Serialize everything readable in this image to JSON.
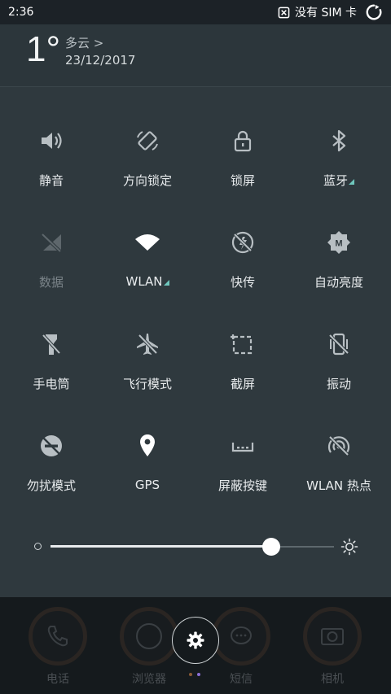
{
  "status_bar": {
    "time": "2:36",
    "sim_text": "没有 SIM 卡"
  },
  "weather": {
    "temperature": "1°",
    "condition": "多云 >",
    "date": "23/12/2017"
  },
  "quick_settings": [
    {
      "label": "静音",
      "icon": "volume-icon",
      "has_more": false,
      "dim": false
    },
    {
      "label": "方向锁定",
      "icon": "rotation-lock-icon",
      "has_more": false,
      "dim": false
    },
    {
      "label": "锁屏",
      "icon": "lock-icon",
      "has_more": false,
      "dim": false
    },
    {
      "label": "蓝牙",
      "icon": "bluetooth-icon",
      "has_more": true,
      "dim": false
    },
    {
      "label": "数据",
      "icon": "mobile-data-off-icon",
      "has_more": false,
      "dim": true
    },
    {
      "label": "WLAN",
      "icon": "wifi-icon",
      "has_more": true,
      "dim": false
    },
    {
      "label": "快传",
      "icon": "quick-transfer-icon",
      "has_more": false,
      "dim": false
    },
    {
      "label": "自动亮度",
      "icon": "auto-brightness-icon",
      "has_more": false,
      "dim": false
    },
    {
      "label": "手电筒",
      "icon": "flashlight-icon",
      "has_more": false,
      "dim": false
    },
    {
      "label": "飞行模式",
      "icon": "airplane-mode-icon",
      "has_more": false,
      "dim": false
    },
    {
      "label": "截屏",
      "icon": "screenshot-icon",
      "has_more": false,
      "dim": false
    },
    {
      "label": "振动",
      "icon": "vibrate-icon",
      "has_more": false,
      "dim": false
    },
    {
      "label": "勿扰模式",
      "icon": "do-not-disturb-icon",
      "has_more": false,
      "dim": false
    },
    {
      "label": "GPS",
      "icon": "location-icon",
      "has_more": false,
      "dim": false
    },
    {
      "label": "屏蔽按键",
      "icon": "block-keys-icon",
      "has_more": false,
      "dim": false
    },
    {
      "label": "WLAN 热点",
      "icon": "hotspot-icon",
      "has_more": false,
      "dim": false
    }
  ],
  "brightness": {
    "level": 0.78
  },
  "dock": {
    "apps": [
      {
        "label": "电话",
        "icon": "phone-icon"
      },
      {
        "label": "浏览器",
        "icon": "browser-icon"
      },
      {
        "label": "短信",
        "icon": "messages-icon"
      },
      {
        "label": "相机",
        "icon": "camera-icon"
      }
    ],
    "settings_icon": "gear-icon",
    "page_dot_colors": [
      "#8a5a35",
      "#8c6fd6"
    ]
  },
  "colors": {
    "accent": "#6fc7bd",
    "panel": "#2f393e",
    "header": "#2c363b"
  }
}
